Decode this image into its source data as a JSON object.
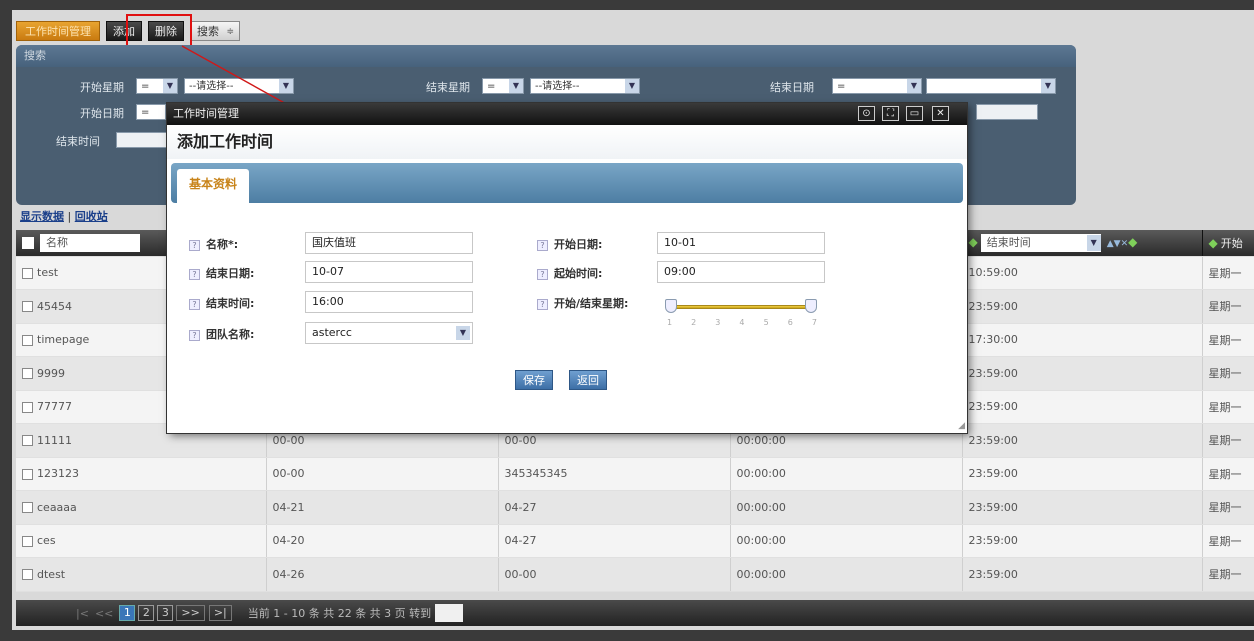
{
  "toolbar": {
    "title_tab": "工作时间管理",
    "add_label": "添加",
    "delete_label": "删除",
    "search_label": "搜索"
  },
  "search_panel": {
    "header": "搜索",
    "start_week_label": "开始星期",
    "end_week_label": "结束星期",
    "end_date_label": "结束日期",
    "start_date_label": "开始日期",
    "end_time_label": "结束时间",
    "op_equals": "=",
    "select_placeholder": "--请选择--"
  },
  "links": {
    "show_data": "显示数据",
    "separator": "|",
    "recycle": "回收站"
  },
  "table": {
    "header_name": "名称",
    "header_end_time": "结束时间",
    "header_start_week": "开始",
    "rows": [
      {
        "name": "test",
        "c2": "",
        "c3": "",
        "c4": "",
        "end_time": "10:59:00",
        "start_week": "星期一"
      },
      {
        "name": "45454",
        "c2": "",
        "c3": "",
        "c4": "",
        "end_time": "23:59:00",
        "start_week": "星期一"
      },
      {
        "name": "timepage",
        "c2": "",
        "c3": "",
        "c4": "",
        "end_time": "17:30:00",
        "start_week": "星期一"
      },
      {
        "name": "9999",
        "c2": "",
        "c3": "",
        "c4": "",
        "end_time": "23:59:00",
        "start_week": "星期一"
      },
      {
        "name": "77777",
        "c2": "",
        "c3": "",
        "c4": "",
        "end_time": "23:59:00",
        "start_week": "星期一"
      },
      {
        "name": "11111",
        "c2": "00-00",
        "c3": "00-00",
        "c4": "00:00:00",
        "end_time": "23:59:00",
        "start_week": "星期一"
      },
      {
        "name": "123123",
        "c2": "00-00",
        "c3": "345345345",
        "c4": "00:00:00",
        "end_time": "23:59:00",
        "start_week": "星期一"
      },
      {
        "name": "ceaaaa",
        "c2": "04-21",
        "c3": "04-27",
        "c4": "00:00:00",
        "end_time": "23:59:00",
        "start_week": "星期一"
      },
      {
        "name": "ces",
        "c2": "04-20",
        "c3": "04-27",
        "c4": "00:00:00",
        "end_time": "23:59:00",
        "start_week": "星期一"
      },
      {
        "name": "dtest",
        "c2": "04-26",
        "c3": "00-00",
        "c4": "00:00:00",
        "end_time": "23:59:00",
        "start_week": "星期一"
      }
    ]
  },
  "pager": {
    "first": "|<",
    "prev": "<<",
    "pages": [
      "1",
      "2",
      "3"
    ],
    "next": ">>",
    "last": ">|",
    "summary": "当前 1 - 10 条 共 22 条 共 3 页 转到"
  },
  "modal": {
    "window_title": "工作时间管理",
    "heading": "添加工作时间",
    "tab_basic": "基本资料",
    "fields": {
      "name_label": "名称*:",
      "name_value": "国庆值班",
      "start_date_label": "开始日期:",
      "start_date_value": "10-01",
      "end_date_label": "结束日期:",
      "end_date_value": "10-07",
      "start_time_label": "起始时间:",
      "start_time_value": "09:00",
      "end_time_label": "结束时间:",
      "end_time_value": "16:00",
      "week_range_label": "开始/结束星期:",
      "team_label": "团队名称:",
      "team_value": "astercc"
    },
    "week_slider": {
      "ticks": [
        "1",
        "2",
        "3",
        "4",
        "5",
        "6",
        "7"
      ],
      "start": 1,
      "end": 7
    },
    "save_label": "保存",
    "back_label": "返回"
  },
  "icons": {
    "question": "?",
    "dropdown": "▼",
    "window_buttons": [
      "⊙",
      "⛶",
      "▭",
      "✕"
    ]
  }
}
